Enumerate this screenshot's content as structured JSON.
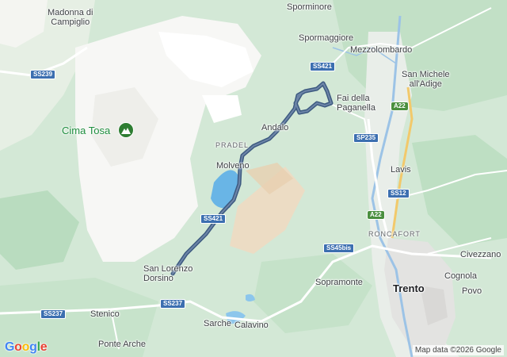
{
  "map": {
    "places": [
      {
        "name": "Madonna di\nCampiglio",
        "kind": "town"
      },
      {
        "name": "Sporminore",
        "kind": "town"
      },
      {
        "name": "Spormaggiore",
        "kind": "town"
      },
      {
        "name": "Mezzolombardo",
        "kind": "town"
      },
      {
        "name": "San Michele\nall'Adige",
        "kind": "town"
      },
      {
        "name": "Fai della\nPaganella",
        "kind": "town"
      },
      {
        "name": "Andalo",
        "kind": "town"
      },
      {
        "name": "PRADEL",
        "kind": "area"
      },
      {
        "name": "Molveno",
        "kind": "town"
      },
      {
        "name": "Lavis",
        "kind": "town"
      },
      {
        "name": "RONCAFORT",
        "kind": "area"
      },
      {
        "name": "Civezzano",
        "kind": "town"
      },
      {
        "name": "San Lorenzo\nDorsino",
        "kind": "town"
      },
      {
        "name": "Sopramonte",
        "kind": "town"
      },
      {
        "name": "Cognola",
        "kind": "town"
      },
      {
        "name": "Trento",
        "kind": "city"
      },
      {
        "name": "Povo",
        "kind": "town"
      },
      {
        "name": "Stenico",
        "kind": "town"
      },
      {
        "name": "Sarche",
        "kind": "town"
      },
      {
        "name": "Calavino",
        "kind": "town"
      },
      {
        "name": "Ponte Arche",
        "kind": "town"
      }
    ],
    "poi": {
      "name": "Cima Tosa",
      "icon": "mountain-peak-icon"
    },
    "road_shields": [
      "SS239",
      "SS421",
      "SS421",
      "A22",
      "SP235",
      "SS12",
      "A22",
      "SS45bis",
      "SS237",
      "SS237"
    ],
    "route_color": "#3d5a80",
    "attribution": "Map data ©2026 Google",
    "logo": {
      "letters": [
        "G",
        "o",
        "o",
        "g",
        "l",
        "e"
      ],
      "colors": [
        "#4285f4",
        "#ea4335",
        "#fbbc05",
        "#4285f4",
        "#34a853",
        "#ea4335"
      ]
    }
  }
}
